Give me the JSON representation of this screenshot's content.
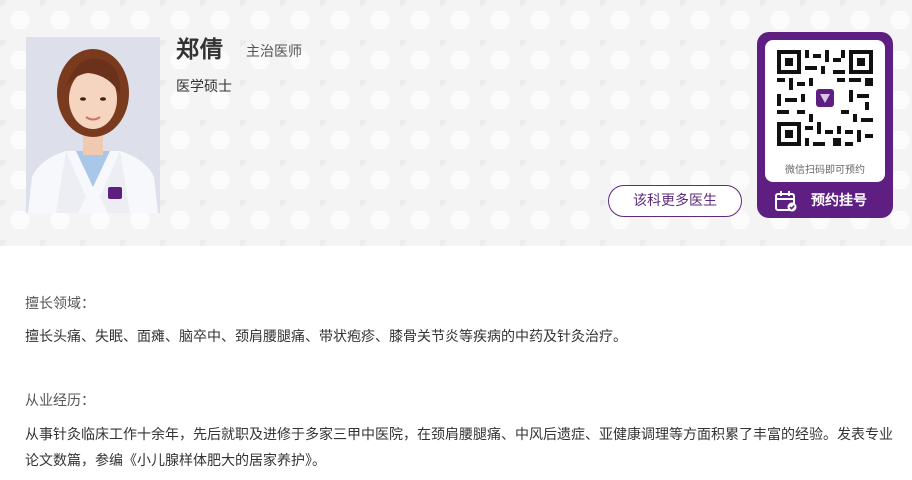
{
  "doctor": {
    "name": "郑倩",
    "title": "主治医师",
    "degree": "医学硕士"
  },
  "buttons": {
    "more_doctors": "该科更多医生",
    "book": "预约挂号"
  },
  "qr": {
    "caption": "微信扫码即可预约"
  },
  "sections": {
    "specialty_label": "擅长领域：",
    "specialty_text": "擅长头痛、失眠、面瘫、脑卒中、颈肩腰腿痛、带状疱疹、膝骨关节炎等疾病的中药及针灸治疗。",
    "experience_label": "从业经历：",
    "experience_text": "从事针灸临床工作十余年，先后就职及进修于多家三甲中医院，在颈肩腰腿痛、中风后遗症、亚健康调理等方面积累了丰富的经验。发表专业论文数篇，参编《小儿腺样体肥大的居家养护》。"
  },
  "colors": {
    "brand_purple": "#5e1e82",
    "header_bg": "#f4f4f4"
  },
  "icons": [
    "doctor-photo",
    "qr-code",
    "calendar-icon"
  ]
}
